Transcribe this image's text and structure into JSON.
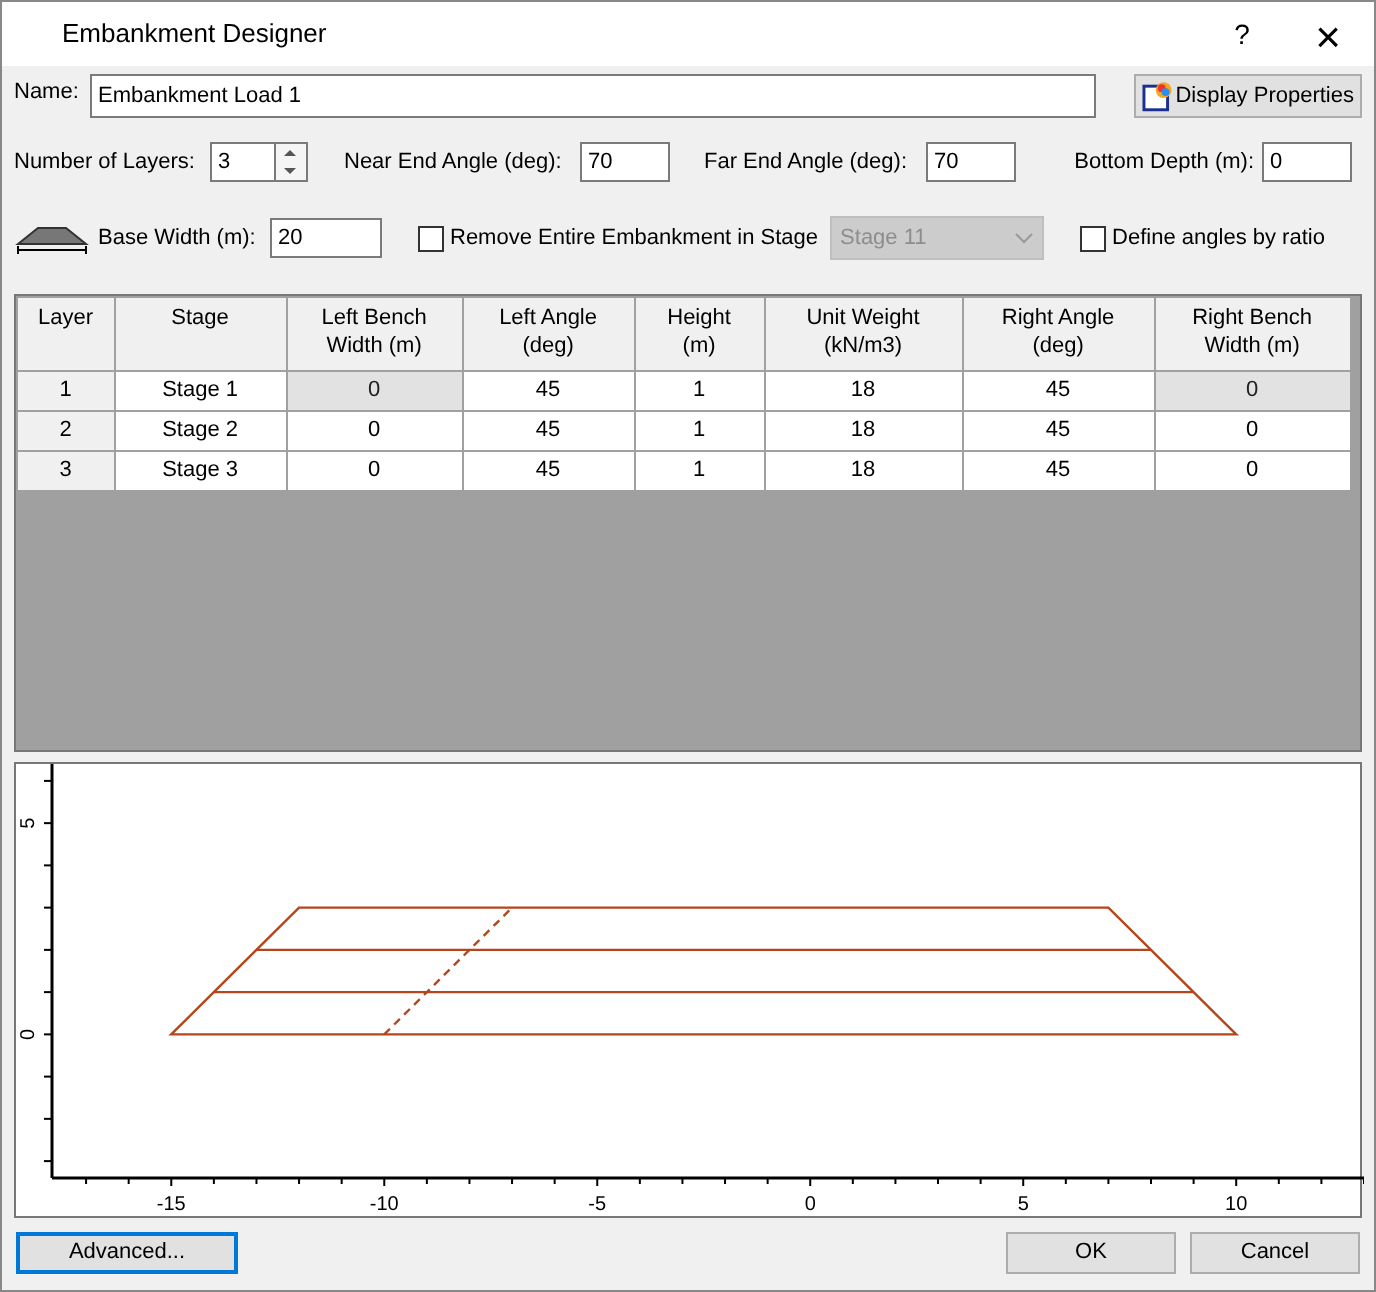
{
  "window": {
    "title": "Embankment Designer",
    "help": "?",
    "close": "×"
  },
  "name_field": {
    "label": "Name:",
    "value": "Embankment Load 1"
  },
  "display_properties_button": "Display Properties",
  "number_of_layers": {
    "label": "Number of Layers:",
    "value": "3"
  },
  "near_end_angle": {
    "label": "Near End Angle (deg):",
    "value": "70"
  },
  "far_end_angle": {
    "label": "Far End Angle (deg):",
    "value": "70"
  },
  "bottom_depth": {
    "label": "Bottom Depth (m):",
    "value": "0"
  },
  "base_width": {
    "label": "Base Width (m):",
    "value": "20"
  },
  "remove_embankment": {
    "label": "Remove Entire Embankment in Stage",
    "checked": false,
    "stage": "Stage 11",
    "disabled": true
  },
  "define_angles_by_ratio": {
    "label": "Define angles by ratio",
    "checked": false
  },
  "table": {
    "columns": [
      "Layer",
      "Stage",
      "Left Bench Width (m)",
      "Left Angle (deg)",
      "Height (m)",
      "Unit Weight (kN/m3)",
      "Right Angle (deg)",
      "Right Bench Width (m)"
    ],
    "rows": [
      {
        "cells": [
          "1",
          "Stage 1",
          "0",
          "45",
          "1",
          "18",
          "45",
          "0"
        ],
        "bench_locked": true
      },
      {
        "cells": [
          "2",
          "Stage 2",
          "0",
          "45",
          "1",
          "18",
          "45",
          "0"
        ],
        "bench_locked": false
      },
      {
        "cells": [
          "3",
          "Stage 3",
          "0",
          "45",
          "1",
          "18",
          "45",
          "0"
        ],
        "bench_locked": false
      }
    ]
  },
  "plot": {
    "x_tick_labels": [
      "-15",
      "-10",
      "-5",
      "0",
      "5",
      "10"
    ],
    "y_tick_labels": [
      "0",
      "5"
    ]
  },
  "buttons": {
    "advanced": "Advanced...",
    "ok": "OK",
    "cancel": "Cancel"
  }
}
